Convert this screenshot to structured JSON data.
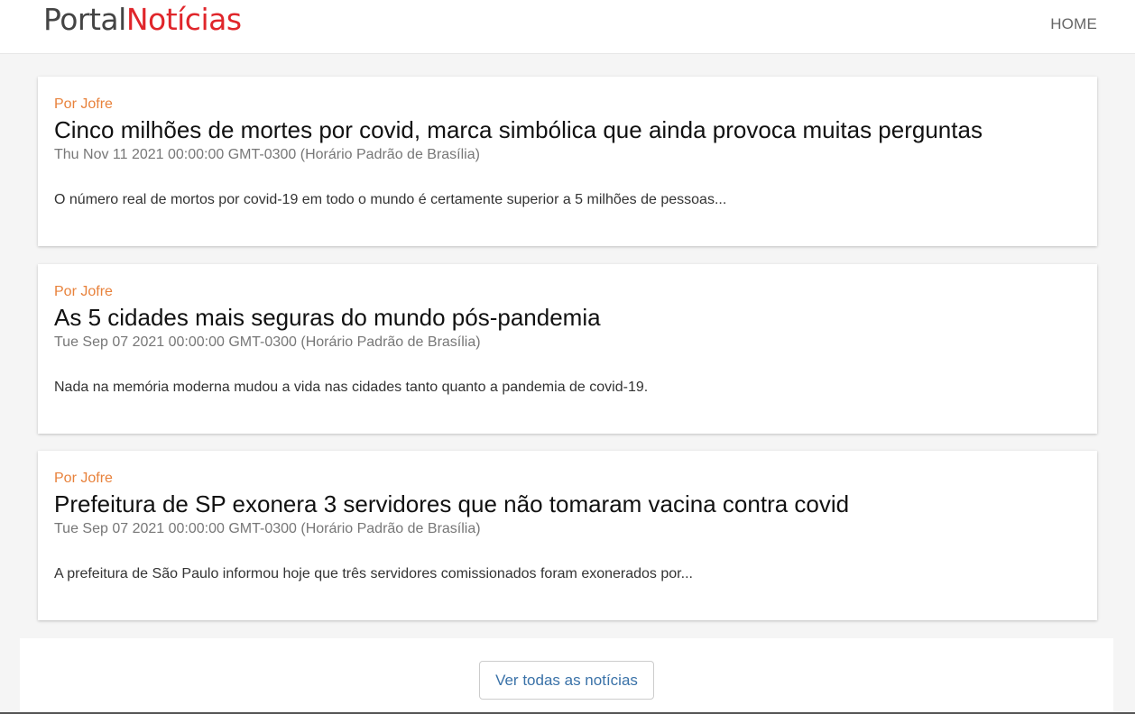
{
  "navbar": {
    "brand_part1": "Portal",
    "brand_part2": "Notícias",
    "home_label": "HOME"
  },
  "articles": [
    {
      "author": "Por Jofre",
      "title": "Cinco milhões de mortes por covid, marca simbólica que ainda provoca muitas perguntas",
      "date": "Thu Nov 11 2021 00:00:00 GMT-0300 (Horário Padrão de Brasília)",
      "summary": "O número real de mortos por covid-19 em todo o mundo é certamente superior a 5 milhões de pessoas..."
    },
    {
      "author": "Por Jofre",
      "title": "As 5 cidades mais seguras do mundo pós-pandemia",
      "date": "Tue Sep 07 2021 00:00:00 GMT-0300 (Horário Padrão de Brasília)",
      "summary": "Nada na memória moderna mudou a vida nas cidades tanto quanto a pandemia de covid-19."
    },
    {
      "author": "Por Jofre",
      "title": "Prefeitura de SP exonera 3 servidores que não tomaram vacina contra covid",
      "date": "Tue Sep 07 2021 00:00:00 GMT-0300 (Horário Padrão de Brasília)",
      "summary": "A prefeitura de São Paulo informou hoje que três servidores comissionados foram exonerados por..."
    }
  ],
  "footer": {
    "all_news_label": "Ver todas as notícias"
  },
  "colors": {
    "brand_accent": "#e0262b",
    "author_accent": "#e8823c",
    "button_text": "#3a72a8"
  }
}
